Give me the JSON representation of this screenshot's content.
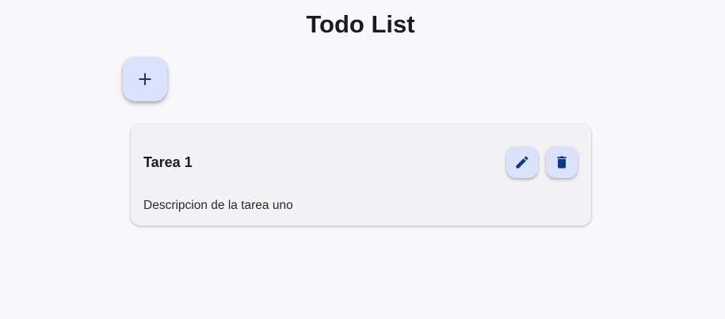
{
  "header": {
    "title": "Todo List"
  },
  "actions": {
    "add_icon": "plus-icon"
  },
  "tasks": [
    {
      "title": "Tarea 1",
      "description": "Descripcion de la tarea uno",
      "edit_icon": "pencil-icon",
      "delete_icon": "trash-icon"
    }
  ],
  "colors": {
    "background": "#f8f7fc",
    "card": "#f3f3f5",
    "button": "#dbe2fb",
    "icon": "#0e3a82",
    "text": "#1b1b1f"
  }
}
